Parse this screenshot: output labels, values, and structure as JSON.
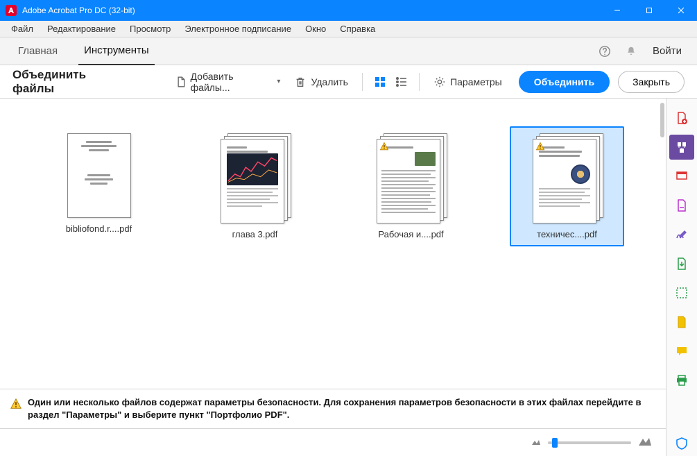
{
  "app": {
    "title": "Adobe Acrobat Pro DC (32-bit)"
  },
  "menu": {
    "file": "Файл",
    "edit": "Редактирование",
    "view": "Просмотр",
    "esign": "Электронное подписание",
    "window": "Окно",
    "help": "Справка"
  },
  "tabs": {
    "home": "Главная",
    "tools": "Инструменты"
  },
  "toolbar": {
    "login": "Войти"
  },
  "action": {
    "heading": "Объединить файлы",
    "add_files": "Добавить файлы...",
    "delete": "Удалить",
    "settings": "Параметры",
    "combine": "Объединить",
    "close": "Закрыть"
  },
  "files": [
    {
      "label": "bibliofond.r....pdf",
      "multipage": false,
      "warn": false,
      "variant": "title"
    },
    {
      "label": "глава 3.pdf",
      "multipage": true,
      "warn": false,
      "variant": "chart"
    },
    {
      "label": "Рабочая и....pdf",
      "multipage": true,
      "warn": true,
      "variant": "photo"
    },
    {
      "label": "техничес....pdf",
      "multipage": true,
      "warn": true,
      "variant": "tech",
      "selected": true
    }
  ],
  "warning": "Один или несколько файлов содержат параметры безопасности. Для сохранения параметров безопасности в этих файлах перейдите в раздел \"Параметры\" и выберите пункт \"Портфолио PDF\"."
}
